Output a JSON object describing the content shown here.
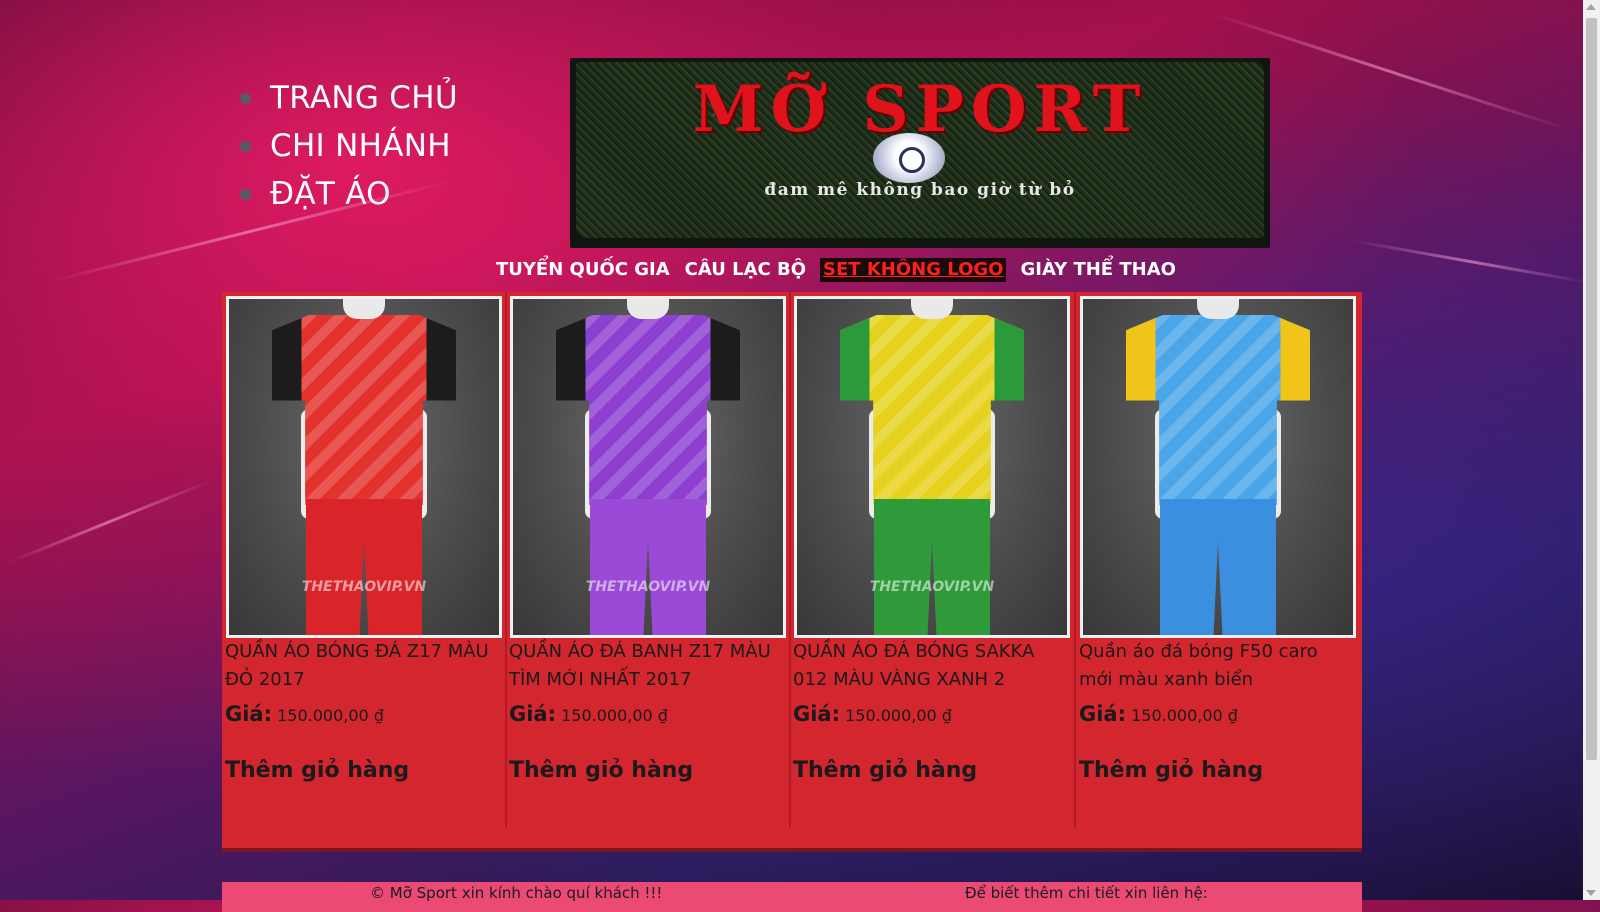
{
  "nav": {
    "items": [
      {
        "label": "TRANG CHỦ"
      },
      {
        "label": "CHI NHÁNH"
      },
      {
        "label": "ĐẶT ÁO"
      }
    ]
  },
  "banner": {
    "title": "MỠ SPORT",
    "tagline": "đam mê không bao giờ từ bỏ"
  },
  "categories": {
    "items": [
      {
        "label": "TUYỂN QUỐC GIA"
      },
      {
        "label": "CÂU LẠC BỘ"
      },
      {
        "label": "SET KHÔNG LOGO",
        "active": true
      },
      {
        "label": "GIÀY THỂ THAO"
      }
    ]
  },
  "products": [
    {
      "name": "QUẦN ÁO BÓNG ĐÁ Z17 MÀU ĐỎ 2017",
      "price_label": "Giá:",
      "price": "150.000,00 ₫",
      "cart_label": "Thêm giỏ hàng",
      "watermark": "THETHAOVIP.VN",
      "colors": {
        "shirt": "#e3322e",
        "accent": "#1c1c1c",
        "shorts": "#d9252a"
      }
    },
    {
      "name": "QUẦN ÁO ĐÁ BANH Z17 MÀU TÌM MỚI NHẤT 2017",
      "price_label": "Giá:",
      "price": "150.000,00 ₫",
      "cart_label": "Thêm giỏ hàng",
      "watermark": "THETHAOVIP.VN",
      "colors": {
        "shirt": "#8c3fd0",
        "accent": "#1c1c1c",
        "shorts": "#9a4ad6"
      }
    },
    {
      "name": "QUẦN ÁO ĐÁ BÓNG SAKKA 012 MÀU VÀNG XANH 2",
      "price_label": "Giá:",
      "price": "150.000,00 ₫",
      "cart_label": "Thêm giỏ hàng",
      "watermark": "THETHAOVIP.VN",
      "colors": {
        "shirt": "#e6d21e",
        "accent": "#2a9a3a",
        "shorts": "#2f9a3a"
      }
    },
    {
      "name": "Quần áo đá bóng F50 caro mới màu xanh biển",
      "price_label": "Giá:",
      "price": "150.000,00 ₫",
      "cart_label": "Thêm giỏ hàng",
      "watermark": "",
      "colors": {
        "shirt": "#4aa6e8",
        "accent": "#f0c419",
        "shorts": "#3a8fe0"
      }
    }
  ],
  "footer": {
    "left": "© Mỡ Sport xin kính chào quí khách !!!",
    "right": "Để biết thêm chi tiết xin liên hệ:"
  }
}
